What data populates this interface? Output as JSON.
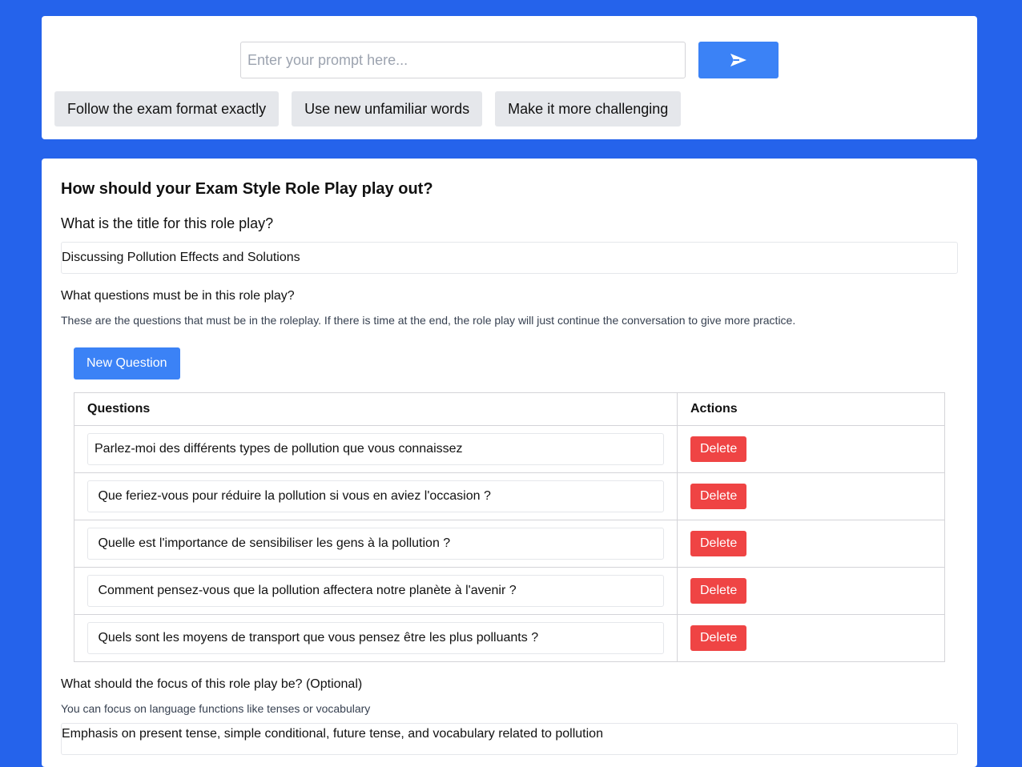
{
  "prompt_bar": {
    "placeholder": "Enter your prompt here...",
    "send_icon": "send-icon",
    "suggestions": [
      "Follow the exam format exactly",
      "Use new unfamiliar words",
      "Make it more challenging"
    ]
  },
  "form": {
    "heading": "How should your Exam Style Role Play play out?",
    "title_label": "What is the title for this role play?",
    "title_value": "Discussing Pollution Effects and Solutions",
    "questions_label": "What questions must be in this role play?",
    "questions_hint": "These are the questions that must be in the roleplay. If there is time at the end, the role play will just continue the conversation to give more practice.",
    "new_question_label": "New Question",
    "table": {
      "headers": [
        "Questions",
        "Actions"
      ],
      "rows": [
        {
          "question": "Parlez-moi des différents types de pollution que vous connaissez",
          "action": "Delete"
        },
        {
          "question": " Que feriez-vous pour réduire la pollution si vous en aviez l'occasion ?",
          "action": "Delete"
        },
        {
          "question": " Quelle est l'importance de sensibiliser les gens à la pollution ?",
          "action": "Delete"
        },
        {
          "question": " Comment pensez-vous que la pollution affectera notre planète à l'avenir ?",
          "action": "Delete"
        },
        {
          "question": " Quels sont les moyens de transport que vous pensez être les plus polluants ?",
          "action": "Delete"
        }
      ]
    },
    "focus_label": "What should the focus of this role play be? (Optional)",
    "focus_hint": "You can focus on language functions like tenses or vocabulary",
    "focus_value": "Emphasis on present tense, simple conditional, future tense, and vocabulary related to pollution"
  },
  "colors": {
    "background": "#2563eb",
    "primary_button": "#3b82f6",
    "delete_button": "#ef4444",
    "chip": "#e5e7eb"
  }
}
